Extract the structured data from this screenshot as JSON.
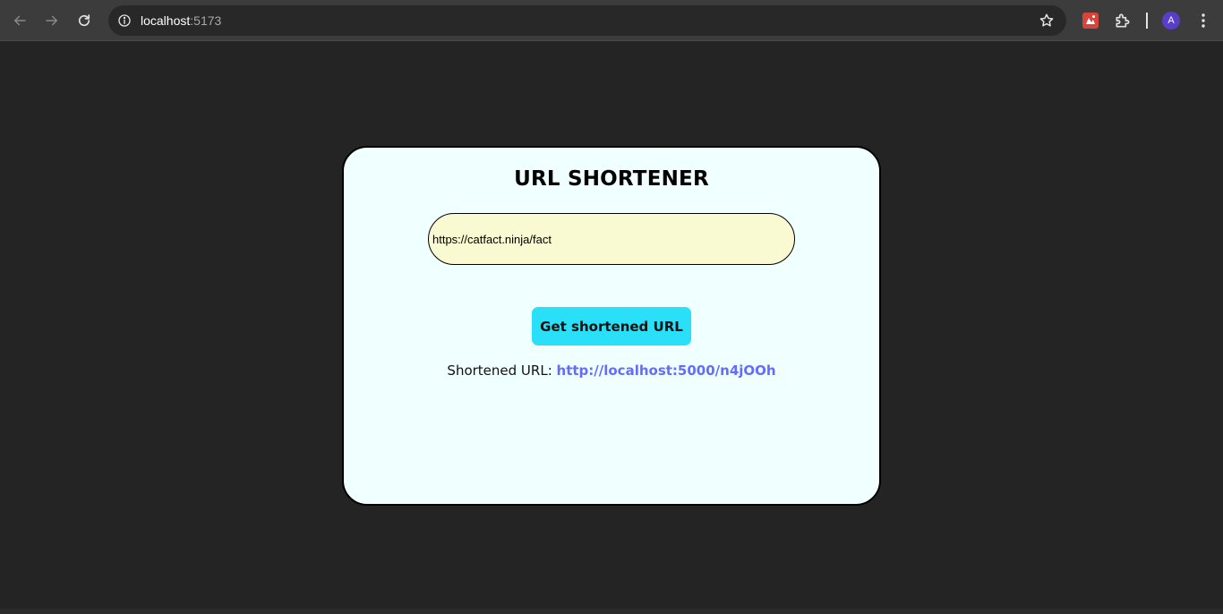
{
  "browser": {
    "url_host": "localhost",
    "url_port": ":5173",
    "avatar_initial": "A",
    "icons": {
      "back": "arrow-left-icon",
      "forward": "arrow-right-icon",
      "reload": "reload-icon",
      "site_info": "info-icon",
      "bookmark": "star-icon",
      "extension_app": "extension-app-icon",
      "extensions": "puzzle-icon",
      "menu": "three-dots-icon"
    }
  },
  "app": {
    "title": "URL SHORTENER",
    "input_value": "https://catfact.ninja/fact",
    "button_label": "Get shortened URL",
    "result_label": "Shortened URL: ",
    "result_link": "http://localhost:5000/n4jOOh"
  },
  "colors": {
    "page_bg": "#242424",
    "card_bg": "#f0ffff",
    "input_bg": "#fafad2",
    "button_bg": "#2ae0f8",
    "link": "#646cff"
  }
}
